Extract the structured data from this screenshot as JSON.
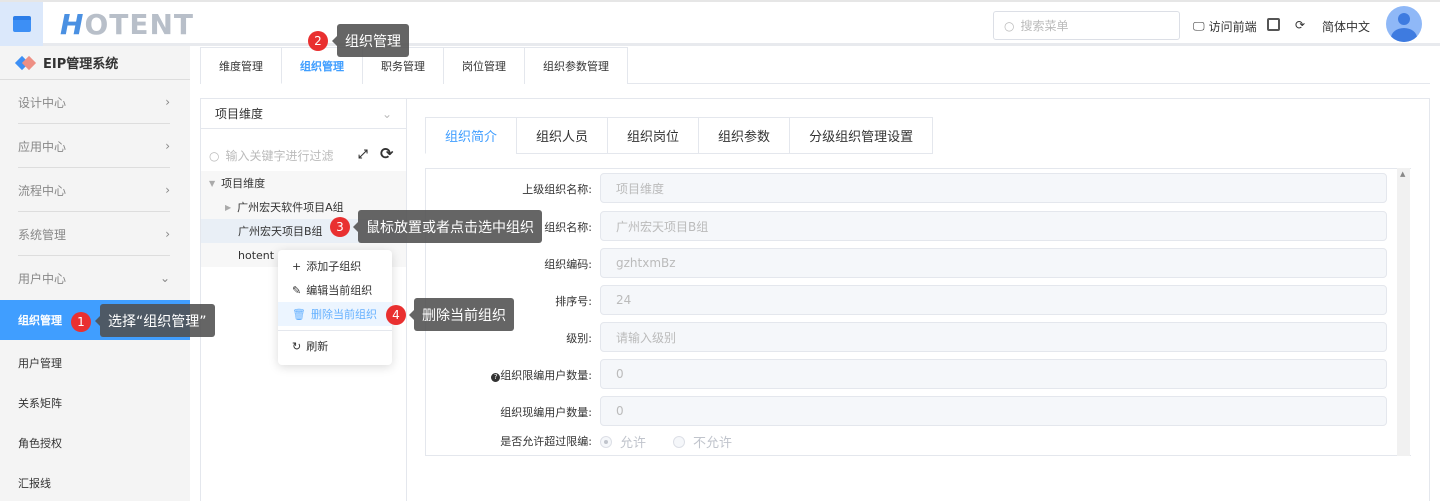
{
  "header": {
    "logo": "HOTENT",
    "logo_h": "H",
    "logo_rest": "OTENT",
    "search_placeholder": "搜索菜单",
    "visit_frontend": "访问前端",
    "language": "简体中文"
  },
  "sidebar": {
    "brand": "EIP管理系统",
    "menus": [
      {
        "label": "设计中心"
      },
      {
        "label": "应用中心"
      },
      {
        "label": "流程中心"
      },
      {
        "label": "系统管理"
      },
      {
        "label": "用户中心"
      }
    ],
    "subitems": [
      {
        "label": "组织管理"
      },
      {
        "label": "用户管理"
      },
      {
        "label": "关系矩阵"
      },
      {
        "label": "角色授权"
      },
      {
        "label": "汇报线"
      }
    ]
  },
  "tabs": [
    "维度管理",
    "组织管理",
    "职务管理",
    "岗位管理",
    "组织参数管理"
  ],
  "left_panel": {
    "dimension": "项目维度",
    "filter_placeholder": "输入关键字进行过滤",
    "tree": [
      "项目维度",
      "广州宏天软件项目A组",
      "广州宏天项目B组",
      "hotent"
    ]
  },
  "context_menu": [
    "添加子组织",
    "编辑当前组织",
    "删除当前组织",
    "刷新"
  ],
  "inner_tabs": [
    "组织简介",
    "组织人员",
    "组织岗位",
    "组织参数",
    "分级组织管理设置"
  ],
  "form": {
    "fields": [
      {
        "label": "上级组织名称:",
        "value": "项目维度"
      },
      {
        "label": "组织名称:",
        "value": "广州宏天项目B组"
      },
      {
        "label": "组织编码:",
        "value": "gzhtxmBz"
      },
      {
        "label": "排序号:",
        "value": "24"
      },
      {
        "label": "级别:",
        "value": "请输入级别"
      },
      {
        "label": "组织限编用户数量:",
        "value": "0"
      },
      {
        "label": "组织现编用户数量:",
        "value": "0"
      }
    ],
    "allow_label": "是否允许超过限编:",
    "allow_yes": "允许",
    "allow_no": "不允许"
  },
  "callouts": [
    {
      "num": "1",
      "text": "选择“组织管理”"
    },
    {
      "num": "2",
      "text": "组织管理"
    },
    {
      "num": "3",
      "text": "鼠标放置或者点击选中组织"
    },
    {
      "num": "4",
      "text": "删除当前组织"
    }
  ]
}
